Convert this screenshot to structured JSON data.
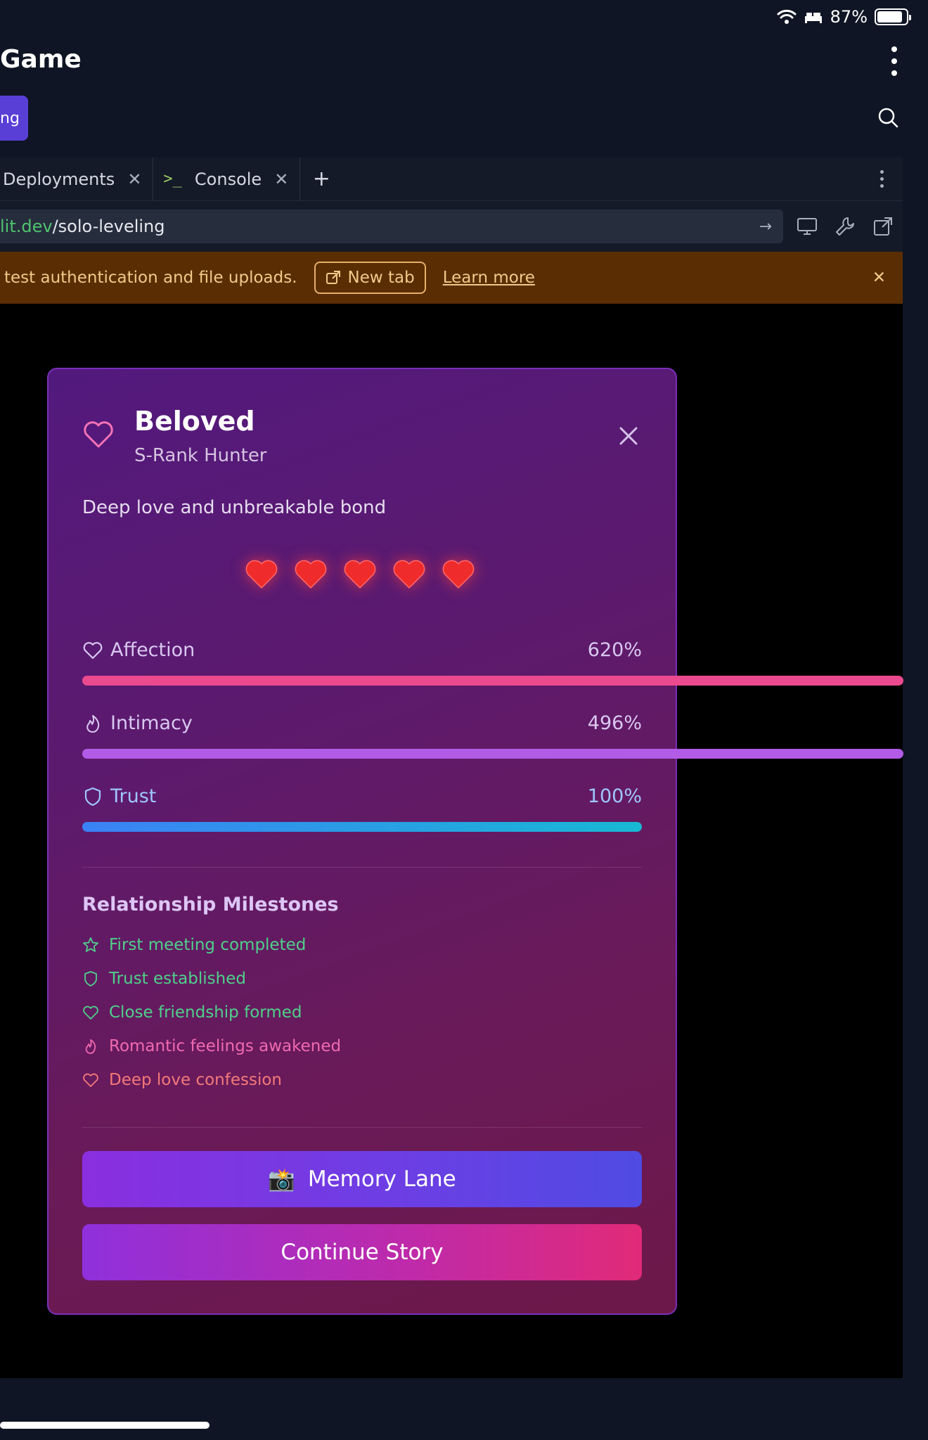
{
  "status_bar": {
    "battery": "87%"
  },
  "app": {
    "title": "Game",
    "run_label": "ng"
  },
  "tabs": [
    {
      "label": "Deployments"
    },
    {
      "label": "Console",
      "prompt": ">_"
    }
  ],
  "tab_add": "+",
  "url": {
    "domain": "lit.dev",
    "path": "/solo-leveling",
    "go": "→"
  },
  "banner": {
    "message": "test authentication and file uploads.",
    "new_tab": "New tab",
    "learn_more": "Learn more",
    "close": "✕"
  },
  "modal": {
    "title": "Beloved",
    "subtitle": "S-Rank Hunter",
    "description": "Deep love and unbreakable bond",
    "hearts_count": 5,
    "stats": [
      {
        "name": "Affection",
        "value": "620%",
        "fraction": 6.2,
        "icon": "heart-icon"
      },
      {
        "name": "Intimacy",
        "value": "496%",
        "fraction": 4.96,
        "icon": "flame-icon"
      },
      {
        "name": "Trust",
        "value": "100%",
        "fraction": 1.0,
        "icon": "shield-icon"
      }
    ],
    "milestones_title": "Relationship Milestones",
    "milestones": [
      {
        "label": "First meeting completed",
        "icon": "star-icon",
        "color": "#4fd08a"
      },
      {
        "label": "Trust established",
        "icon": "shield-icon",
        "color": "#4fd08a"
      },
      {
        "label": "Close friendship formed",
        "icon": "heart-icon",
        "color": "#4fd08a"
      },
      {
        "label": "Romantic feelings awakened",
        "icon": "flame-icon",
        "color": "#f06ab0"
      },
      {
        "label": "Deep love confession",
        "icon": "heart-icon",
        "color": "#f47a7a"
      }
    ],
    "memory_button": "Memory Lane",
    "memory_emoji": "📸",
    "continue_button": "Continue Story"
  },
  "colors": {
    "affection_bar": "#ec4a8f",
    "intimacy_bar": "#b25be6",
    "trust_bar_start": "#3b82f6",
    "trust_bar_end": "#18b8d4"
  }
}
